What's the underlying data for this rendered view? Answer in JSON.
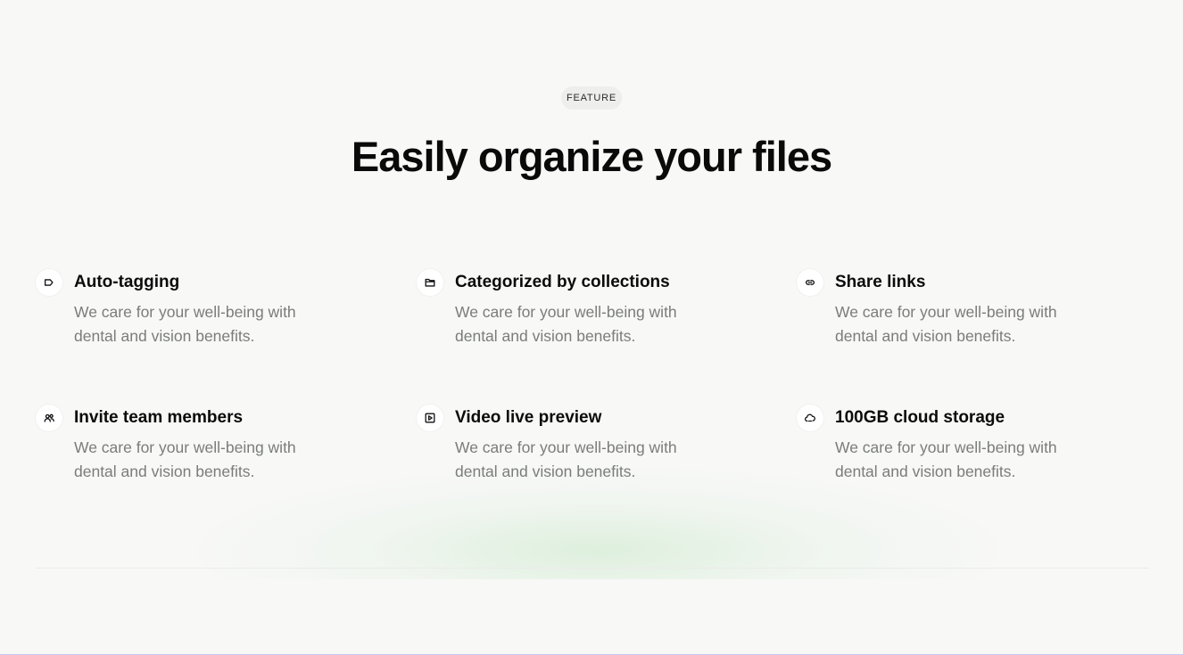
{
  "section": {
    "badge": "FEATURE",
    "title": "Easily organize your files"
  },
  "features": [
    {
      "icon": "tag-icon",
      "title": "Auto-tagging",
      "description": "We care for your well-being with dental and vision benefits."
    },
    {
      "icon": "folder-icon",
      "title": "Categorized by collections",
      "description": "We care for your well-being with dental and vision benefits."
    },
    {
      "icon": "link-icon",
      "title": "Share links",
      "description": "We care for your well-being with dental and vision benefits."
    },
    {
      "icon": "users-icon",
      "title": "Invite team members",
      "description": "We care for your well-being with dental and vision benefits."
    },
    {
      "icon": "play-square-icon",
      "title": "Video live preview",
      "description": "We care for your well-being with dental and vision benefits."
    },
    {
      "icon": "cloud-icon",
      "title": "100GB cloud storage",
      "description": "We care for your well-being with dental and vision benefits."
    }
  ]
}
